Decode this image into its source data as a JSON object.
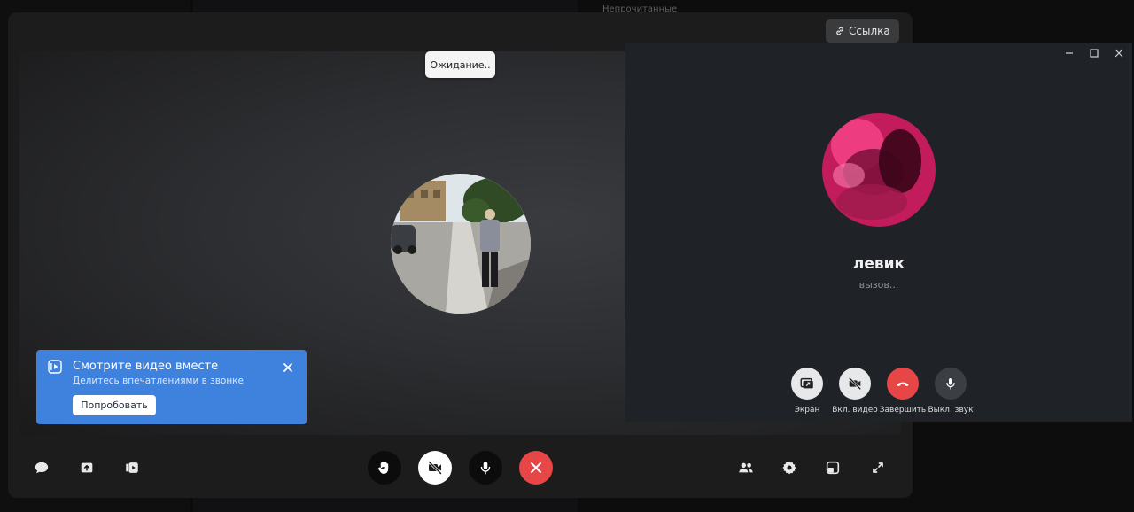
{
  "background": {
    "unread_label": "Непрочитанные"
  },
  "call": {
    "link_button_label": "Ссылка",
    "waiting_label": "Ожидание..",
    "promo": {
      "title": "Смотрите видео вместе",
      "subtitle": "Делитесь впечатлениями в звонке",
      "button_label": "Попробовать",
      "accent_color": "#3e82de"
    },
    "toolbar": {
      "left_icons": [
        "chat-icon",
        "share-screen-icon",
        "watch-together-icon"
      ],
      "center_icons": [
        "raise-hand-icon",
        "camera-off-icon",
        "microphone-icon",
        "hangup-icon"
      ],
      "right_icons": [
        "participants-icon",
        "settings-icon",
        "layout-icon",
        "fullscreen-icon"
      ],
      "hangup_color": "#e64646"
    }
  },
  "mini_window": {
    "contact_name": "левик",
    "status": "вызов...",
    "buttons": [
      {
        "label": "Экран",
        "icon": "screen-share-icon"
      },
      {
        "label": "Вкл. видео",
        "icon": "camera-off-icon"
      },
      {
        "label": "Завершить",
        "icon": "hangup-icon"
      },
      {
        "label": "Выкл. звук",
        "icon": "microphone-icon"
      }
    ]
  }
}
